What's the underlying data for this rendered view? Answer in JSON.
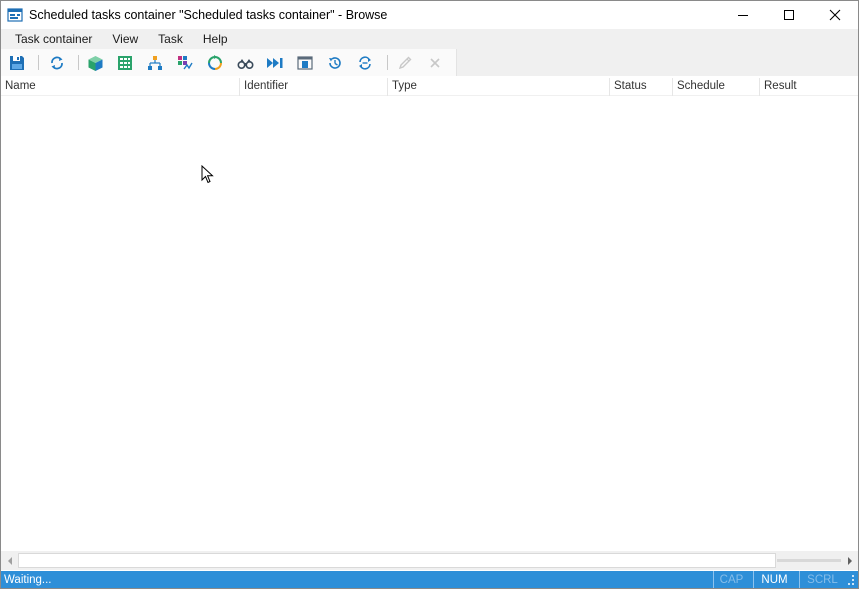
{
  "window": {
    "title": "Scheduled tasks container \"Scheduled tasks container\" - Browse",
    "icon": "scheduled-tasks-app-icon",
    "controls": [
      "minimize-icon",
      "maximize-icon",
      "close-icon"
    ]
  },
  "menu": {
    "items": [
      "Task container",
      "View",
      "Task",
      "Help"
    ]
  },
  "toolbar": {
    "buttons": [
      "save-icon",
      "refresh-icon",
      "cube-icon",
      "table-icon",
      "hierarchy-icon",
      "chart-icon",
      "cycle-icon",
      "binoculars-icon",
      "run-icon",
      "panel-icon",
      "history-icon",
      "sync-icon",
      "edit-icon",
      "delete-icon"
    ]
  },
  "columns": [
    "Name",
    "Identifier",
    "Type",
    "Status",
    "Schedule",
    "Result"
  ],
  "status": {
    "text": "Waiting...",
    "indicators": [
      {
        "label": "CAP",
        "active": false
      },
      {
        "label": "NUM",
        "active": true
      },
      {
        "label": "SCRL",
        "active": false
      }
    ]
  },
  "colors": {
    "statusbar": "#2e8fd8",
    "accent_blue": "#1e7bc4",
    "accent_green": "#2aa36b"
  }
}
